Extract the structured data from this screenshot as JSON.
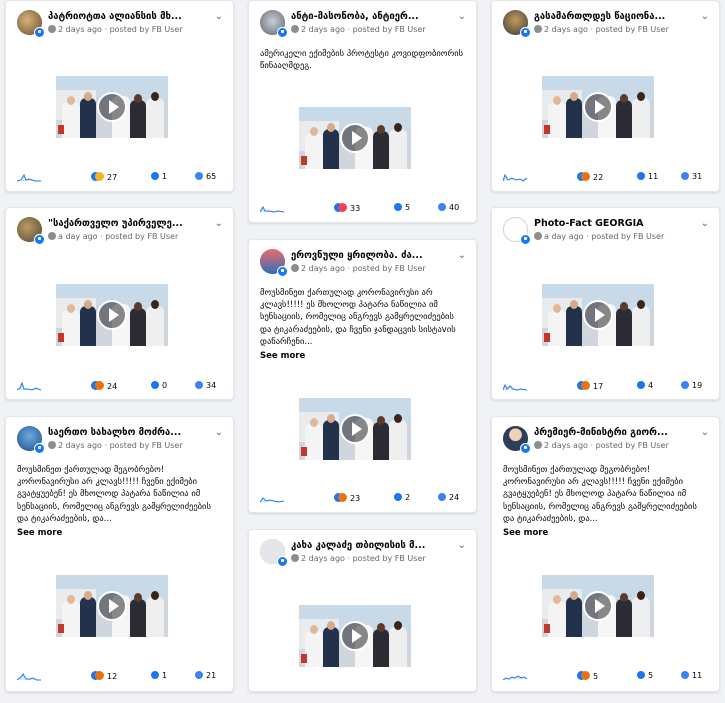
{
  "meta_suffix": "posted by FB User",
  "see_more": "See more",
  "colors": {
    "accent": "#1877f2",
    "background": "#f0f2f5",
    "reaction_like": "#1877f2",
    "reaction_haha": "#f7b125",
    "reaction_angry": "#e9710f",
    "reaction_love": "#f33e58"
  },
  "posts": [
    {
      "name": "პატრიოტთა ალიანსის მხ...",
      "time": "2 days ago",
      "message": "",
      "reactions": "27",
      "comments": "1",
      "shares": "65"
    },
    {
      "name": "ანტი-მასონობა, ანტიერ...",
      "time": "2 days ago",
      "message": "ამერიკელი ექიმების პროტესტი კოვიდფობიორის წინააღმდეგ.",
      "reactions": "33",
      "comments": "5",
      "shares": "40"
    },
    {
      "name": "გასამართლდეს წაციონა...",
      "time": "2 days ago",
      "message": "",
      "reactions": "22",
      "comments": "11",
      "shares": "31"
    },
    {
      "name": "\"საქართველო უპირველე...",
      "time": "a day ago",
      "message": "",
      "reactions": "24",
      "comments": "0",
      "shares": "34"
    },
    {
      "name": "ეროვნული ყრილობა. ძა...",
      "time": "2 days ago",
      "message": "მოუსმინეთ ქართულად კორონავირუსი არ კლავს!!!!! ეს მხოლოდ პატარა ნაწილია იმ სენსაციის, რომელიც ანგრევს გამყრელიძეების და ტიკარაძეების, და ჩვენი ჯანდაცვის სისტაvის დანარჩენი...",
      "reactions": "23",
      "comments": "2",
      "shares": "24"
    },
    {
      "name": "Photo-Fact GEORGIA",
      "time": "a day ago",
      "message": "",
      "reactions": "17",
      "comments": "4",
      "shares": "19"
    },
    {
      "name": "საერთო სახალხო მოძრა...",
      "time": "2 days ago",
      "message": "მოუსმინეთ ქართულად მეგობრებო! კორონავირუსი არ კლავს!!!!! ჩვენი ექიმები გვატყუებენ! ეს მხოლოდ პატარა ნაწილია იმ სენსაციის, რომელიც ანგრევს გამყრელიძეების და ტიკარაძეების, და...",
      "reactions": "12",
      "comments": "1",
      "shares": "21"
    },
    {
      "name": "კახა კალაძე თბილისის მ...",
      "time": "2 days ago",
      "message": "",
      "reactions": "",
      "comments": "",
      "shares": ""
    },
    {
      "name": "პრემიერ-მინისტრი გიორ...",
      "time": "2 days ago",
      "message": "მოუსმინეთ ქართულად მეგობრებო! კორონავირუსი არ კლავს!!!!! ჩვენი ექიმები გვატყუებენ! ეს მხოლოდ პატარა ნაწილია იმ სენსაციის, რომელიც ანგრევს გამყრელიძეების და ტიკარაძეების, და...",
      "reactions": "5",
      "comments": "5",
      "shares": "11"
    }
  ]
}
